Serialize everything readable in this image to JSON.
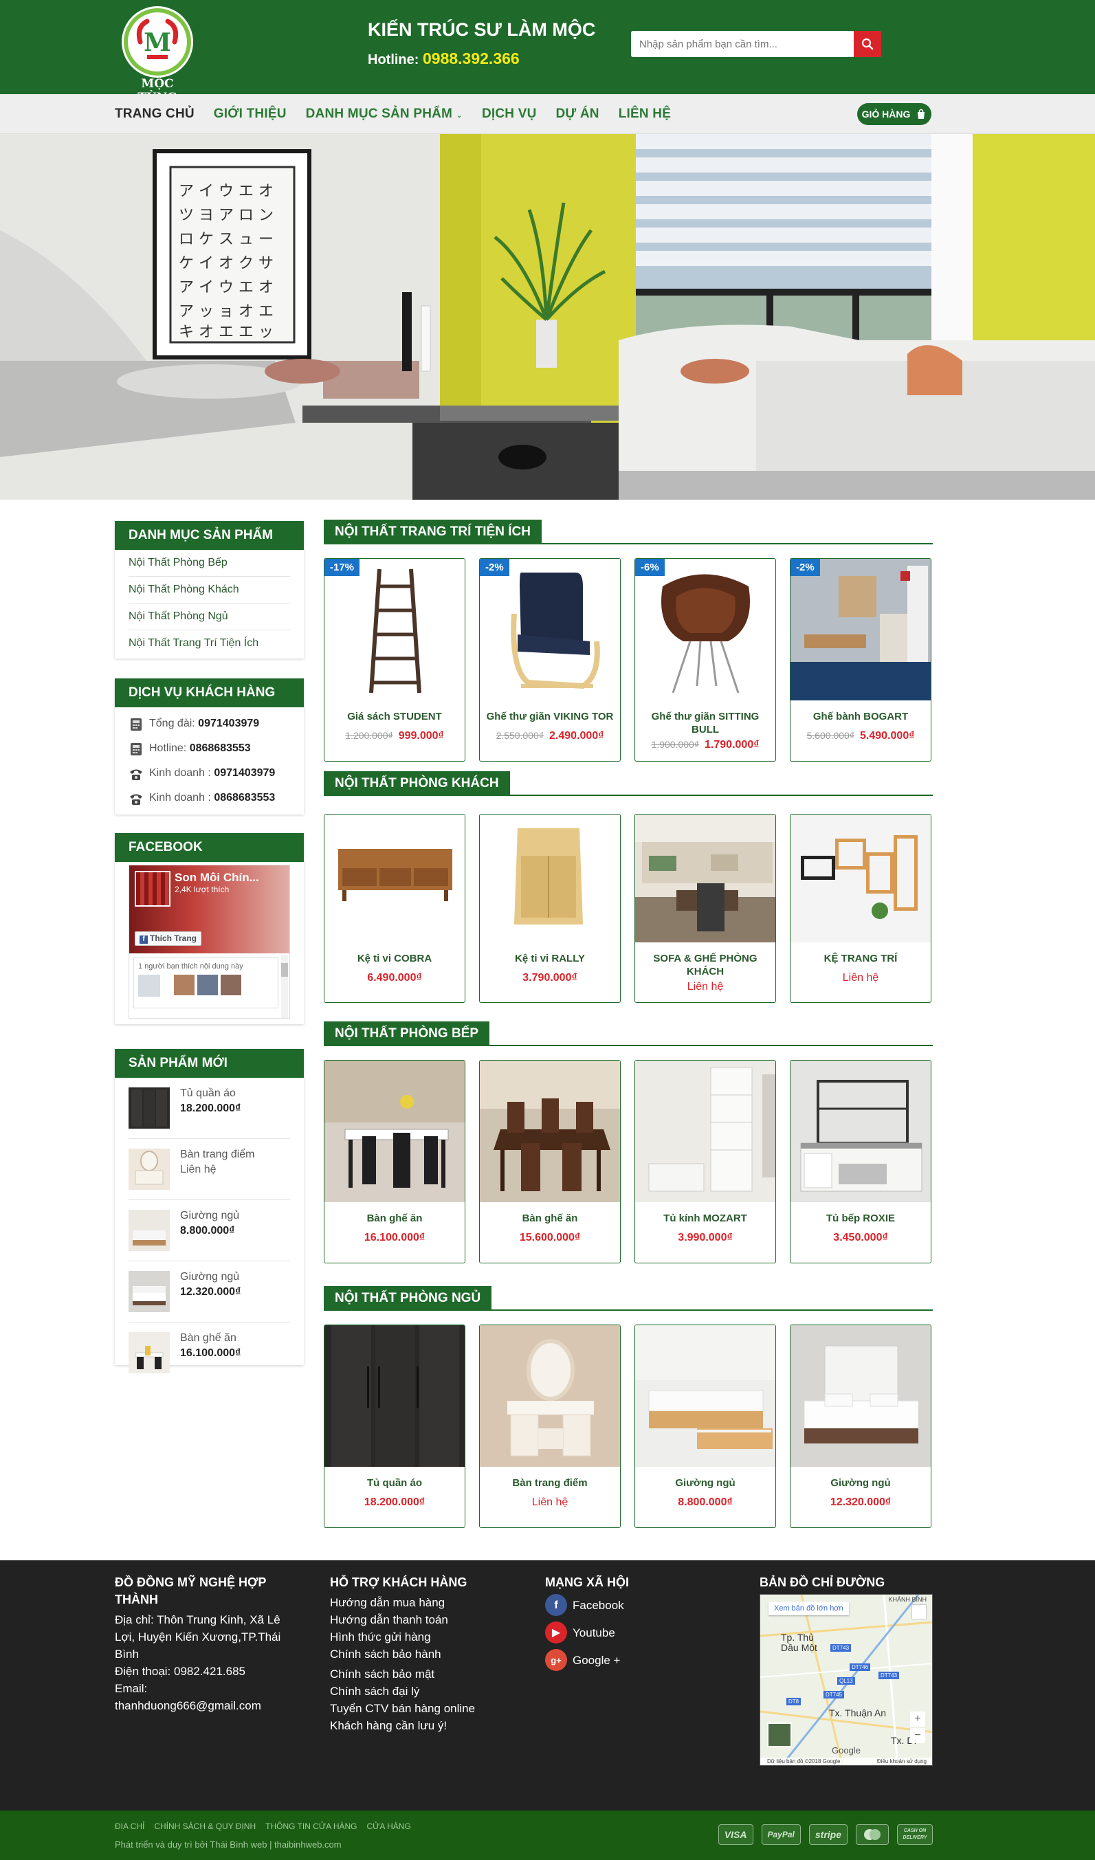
{
  "header": {
    "logo_text": "MỘC TÙNG",
    "slogan": "KIẾN TRÚC SƯ LÀM MỘC",
    "hotline_label": "Hotline:",
    "hotline_number": "0988.392.366",
    "search_placeholder": "Nhập sản phẩm bạn cần tìm...",
    "brand_color": "#1f6a2b"
  },
  "nav": {
    "items": [
      "TRANG CHỦ",
      "GIỚI THIỆU",
      "DANH MỤC SẢN PHẨM",
      "DỊCH VỤ",
      "DỰ ÁN",
      "LIÊN HỆ"
    ],
    "cart_label": "GIỎ HÀNG"
  },
  "sidebar": {
    "categories": {
      "title": "DANH MỤC SẢN PHẨM",
      "items": [
        "Nội Thất Phòng Bếp",
        "Nội Thất Phòng Khách",
        "Nội Thất Phòng Ngủ",
        "Nội Thất Trang Trí Tiện Ích"
      ]
    },
    "service": {
      "title": "DỊCH VỤ KHÁCH HÀNG",
      "lines": [
        {
          "label": "Tổng đài:",
          "value": "0971403979"
        },
        {
          "label": "Hotline:",
          "value": "0868683553"
        },
        {
          "label": "Kinh doanh :",
          "value": "0971403979"
        },
        {
          "label": "Kinh doanh :",
          "value": "0868683553"
        }
      ]
    },
    "facebook": {
      "title": "FACEBOOK",
      "page_name": "Son Môi Chín...",
      "likes": "2,4K lượt thích",
      "like_button": "Thích Trang",
      "friends_text": "1 người bạn thích nội dung này"
    },
    "new_products": {
      "title": "SẢN PHẨM MỚI",
      "items": [
        {
          "name": "Tủ quần áo",
          "price": "18.200.000₫"
        },
        {
          "name": "Bàn trang điểm",
          "price": "Liên hệ"
        },
        {
          "name": "Giường ngủ",
          "price": "8.800.000₫"
        },
        {
          "name": "Giường ngủ",
          "price": "12.320.000₫"
        },
        {
          "name": "Bàn ghế ăn",
          "price": "16.100.000₫"
        }
      ]
    }
  },
  "sections": [
    {
      "title": "NỘI THẤT TRANG TRÍ TIỆN ÍCH",
      "products": [
        {
          "badge": "-17%",
          "name": "Giá sách STUDENT",
          "old_price": "1.200.000₫",
          "price": "999.000₫"
        },
        {
          "badge": "-2%",
          "name": "Ghế thư giãn VIKING TOR",
          "old_price": "2.550.000₫",
          "price": "2.490.000₫"
        },
        {
          "badge": "-6%",
          "name": "Ghế thư giãn SITTING BULL",
          "old_price": "1.900.000₫",
          "price": "1.790.000₫"
        },
        {
          "badge": "-2%",
          "name": "Ghế bành BOGART",
          "old_price": "5.600.000₫",
          "price": "5.490.000₫"
        }
      ]
    },
    {
      "title": "NỘI THẤT PHÒNG KHÁCH",
      "products": [
        {
          "name": "Kệ ti vi COBRA",
          "price": "6.490.000₫"
        },
        {
          "name": "Kệ ti vi RALLY",
          "price": "3.790.000₫"
        },
        {
          "name": "SOFA & GHẾ PHÒNG KHÁCH",
          "price": "Liên hệ"
        },
        {
          "name": "KỆ TRANG TRÍ",
          "price": "Liên hệ"
        }
      ]
    },
    {
      "title": "NỘI THẤT PHÒNG BẾP",
      "products": [
        {
          "name": "Bàn ghế ăn",
          "price": "16.100.000₫"
        },
        {
          "name": "Bàn ghế ăn",
          "price": "15.600.000₫"
        },
        {
          "name": "Tủ kính MOZART",
          "price": "3.990.000₫"
        },
        {
          "name": "Tủ bếp ROXIE",
          "price": "3.450.000₫"
        }
      ]
    },
    {
      "title": "NỘI THẤT PHÒNG NGỦ",
      "products": [
        {
          "name": "Tủ quần áo",
          "price": "18.200.000₫"
        },
        {
          "name": "Bàn trang điểm",
          "price": "Liên hệ"
        },
        {
          "name": "Giường ngủ",
          "price": "8.800.000₫"
        },
        {
          "name": "Giường ngủ",
          "price": "12.320.000₫"
        }
      ]
    }
  ],
  "footer": {
    "company": {
      "title": "ĐỒ ĐỒNG MỸ NGHỆ HỢP THÀNH",
      "address": "Địa chỉ: Thôn Trung Kinh, Xã Lê Lợi, Huyện Kiến Xương,TP.Thái Bình",
      "phone": "Điện thoại: 0982.421.685",
      "email_label": "Email:",
      "email": "thanhduong666@gmail.com"
    },
    "support": {
      "title": "HỖ TRỢ KHÁCH HÀNG",
      "links": [
        "Hướng dẫn mua hàng",
        "Hướng dẫn thanh toán",
        "Hình thức gửi hàng",
        "Chính sách bảo hành",
        "Chính sách bảo mật",
        "Chính sách đại lý",
        "Tuyển CTV bán hàng online",
        "Khách hàng cần lưu ý!"
      ]
    },
    "social": {
      "title": "MẠNG XÃ HỘI",
      "items": [
        {
          "label": "Facebook",
          "icon": "facebook-icon",
          "color": "#3b5998"
        },
        {
          "label": "Youtube",
          "icon": "youtube-icon",
          "color": "#d9242a"
        },
        {
          "label": "Google +",
          "icon": "google-plus-icon",
          "color": "#dd4b39"
        }
      ]
    },
    "map": {
      "title": "BẢN ĐỒ CHỈ ĐƯỜNG",
      "view_larger": "Xem bản đồ lớn hơn",
      "labels": [
        "Tp. Thủ Dầu Một",
        "Tx. Thuận An",
        "Tx. Dĩ",
        "KHÁNH BÌNH"
      ],
      "roads": [
        "DT743",
        "DT746",
        "DT743",
        "QL13",
        "DT745",
        "DT8"
      ],
      "google": "Google",
      "attribution": "Dữ liệu bản đồ ©2018 Google",
      "terms": "Điều khoản sử dụng"
    }
  },
  "bottom": {
    "links": [
      "ĐỊA CHỈ",
      "CHÍNH SÁCH & QUY ĐỊNH",
      "THÔNG TIN CỬA HÀNG",
      "CỬA HÀNG"
    ],
    "copyright": "Phát triển và duy trì bởi Thái Bình web | thaibinhweb.com",
    "payments": [
      "VISA",
      "PayPal",
      "stripe",
      "mastercard",
      "CASH ON DELIVERY"
    ]
  }
}
